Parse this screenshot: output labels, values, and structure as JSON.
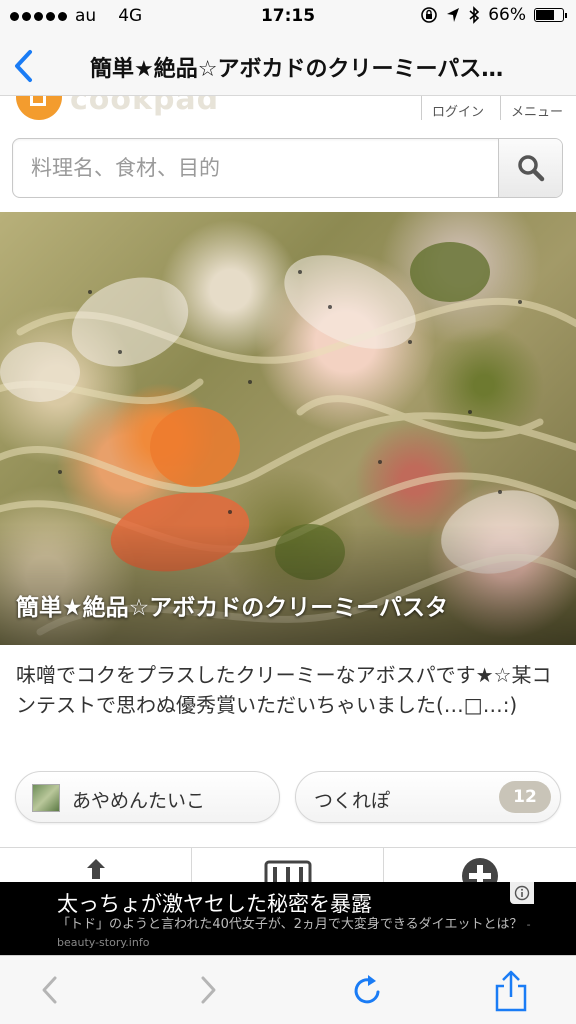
{
  "status_bar": {
    "carrier": "au",
    "network": "4G",
    "time": "17:15",
    "battery": "66%",
    "battery_level": 0.66
  },
  "nav": {
    "title": "簡単★絶品☆アボカドのクリーミーパス…"
  },
  "header": {
    "logo_text": "cookpad",
    "login_label": "ログイン",
    "menu_label": "メニュー",
    "accent_color": "#f39c2e"
  },
  "search": {
    "placeholder": "料理名、食材、目的",
    "value": ""
  },
  "recipe": {
    "title": "簡単★絶品☆アボカドのクリーミーパスタ",
    "description": "味噌でコクをプラスしたクリーミーなアボスパです★☆某コンテストで思わぬ優秀賞いただいちゃいました(…□…:)",
    "author": "あやめんたいこ",
    "tsukurepo_label": "つくれぽ",
    "tsukurepo_count": "12"
  },
  "ad": {
    "title": "太っちょが激ヤセした秘密を暴露",
    "text": "「トド」のようと言われた40代女子が、2ヵ月で大変身できるダイエットとは？",
    "source": "- beauty-story.info"
  },
  "icons": {
    "back": "chevron-left-icon",
    "search": "magnifier-icon",
    "share": "share-icon",
    "reload": "reload-icon"
  }
}
